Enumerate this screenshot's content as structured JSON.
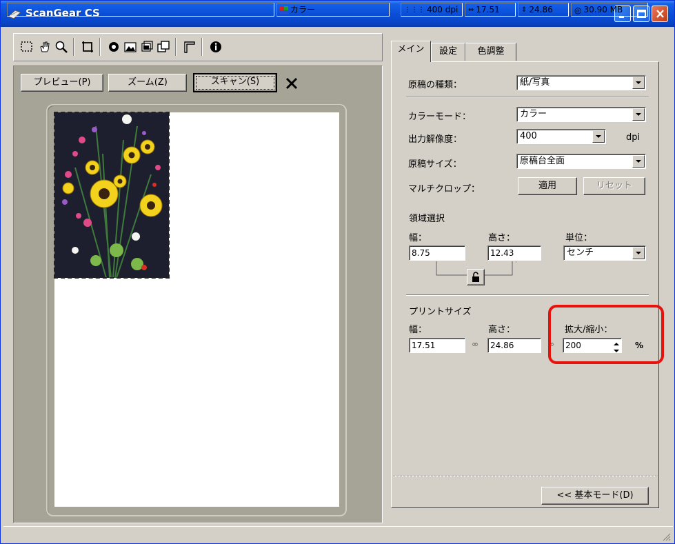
{
  "window": {
    "title": "ScanGear CS"
  },
  "toolbar": {
    "tools": [
      "select-icon",
      "hand-icon",
      "magnifier-icon",
      "crop-icon",
      "invert-icon",
      "mountain-icon",
      "color-icon",
      "copy-icon",
      "frame-icon",
      "info-icon"
    ]
  },
  "preview": {
    "preview_label": "プレビュー(P)",
    "zoom_label": "ズーム(Z)",
    "scan_label": "スキャン(S)"
  },
  "tabs": [
    "メイン",
    "設定",
    "色調整"
  ],
  "main": {
    "source_type": {
      "label": "原稿の種類：",
      "value": "紙/写真"
    },
    "color_mode": {
      "label": "カラーモード：",
      "value": "カラー"
    },
    "resolution": {
      "label": "出力解像度：",
      "value": "400",
      "unit": "dpi"
    },
    "source_size": {
      "label": "原稿サイズ：",
      "value": "原稿台全面"
    },
    "multi_crop": {
      "label": "マルチクロップ：",
      "apply": "適用",
      "reset": "リセット"
    },
    "area": {
      "title": "領域選択",
      "width_label": "幅：",
      "width": "8.75",
      "height_label": "高さ：",
      "height": "12.43",
      "unit_label": "単位：",
      "unit": "センチ"
    },
    "print": {
      "title": "プリントサイズ",
      "width_label": "幅：",
      "width": "17.51",
      "height_label": "高さ：",
      "height": "24.86",
      "scale_label": "拡大/縮小：",
      "scale": "200",
      "scale_unit": "%"
    },
    "basic_mode": "<< 基本モード(D)"
  },
  "status": {
    "color": "カラー",
    "dpi": "400 dpi",
    "width": "17.51",
    "height": "24.86",
    "size": "30.90 MB"
  },
  "colors": {
    "title_bar": "#0a4fd8",
    "highlight": "#e8120c",
    "face": "#d4d0c8"
  }
}
